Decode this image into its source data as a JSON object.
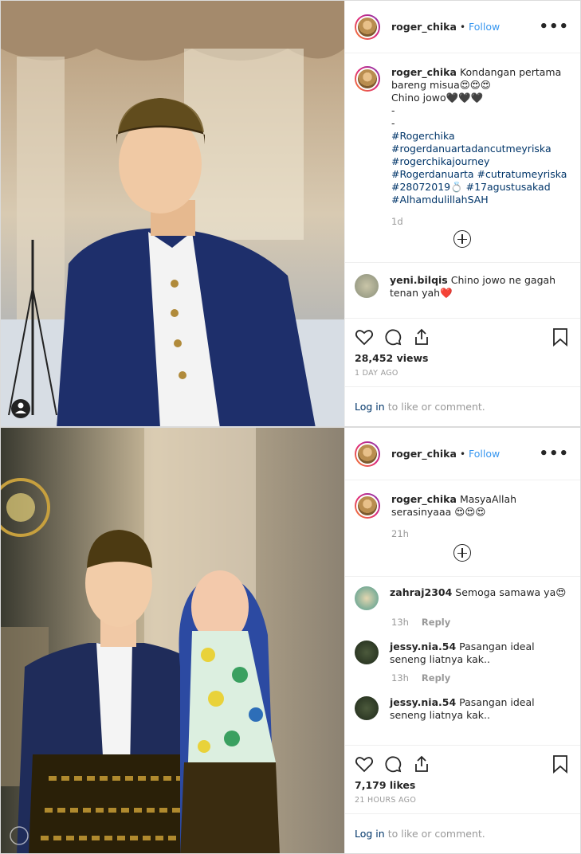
{
  "posts": [
    {
      "username": "roger_chika",
      "follow_label": "Follow",
      "more_label": "•••",
      "caption": {
        "username": "roger_chika",
        "line1": "Kondangan pertama bareng misua😍😍😍",
        "line2": "Chino jowo🖤🖤🖤",
        "line3": "-",
        "line4": "-",
        "tags": [
          "#Rogerchika",
          "#rogerdanuartadancutmeyriska",
          "#rogerchikajourney",
          "#Rogerdanuarta #cutratumeyriska",
          "#28072019💍 #17agustusakad",
          "#AlhamdulillahSAH"
        ],
        "time": "1d"
      },
      "comments": [
        {
          "username": "yeni.bilqis",
          "text": "Chino jowo ne gagah tenan yah❤️"
        }
      ],
      "stats": "28,452 views",
      "timestamp": "1 DAY AGO",
      "login_link": "Log in",
      "login_rest": "to like or comment."
    },
    {
      "username": "roger_chika",
      "follow_label": "Follow",
      "more_label": "•••",
      "caption": {
        "username": "roger_chika",
        "line1": "MasyaAllah serasinyaaa 😍😍😍",
        "time": "21h"
      },
      "comments": [
        {
          "username": "zahraj2304",
          "text": "Semoga samawa ya😍",
          "time": "13h",
          "reply": "Reply"
        },
        {
          "username": "jessy.nia.54",
          "text": "Pasangan ideal seneng liatnya kak..",
          "time": "13h",
          "reply": "Reply"
        },
        {
          "username": "jessy.nia.54",
          "text": "Pasangan ideal seneng liatnya kak.."
        }
      ],
      "stats": "7,179 likes",
      "timestamp": "21 HOURS AGO",
      "login_link": "Log in",
      "login_rest": "to like or comment."
    }
  ],
  "colors": {
    "link": "#003569",
    "follow": "#3897f0",
    "muted": "#999999"
  },
  "icons": [
    "heart-icon",
    "comment-icon",
    "share-icon",
    "bookmark-icon",
    "more-icon",
    "add-comment-icon",
    "user-tag-icon"
  ]
}
